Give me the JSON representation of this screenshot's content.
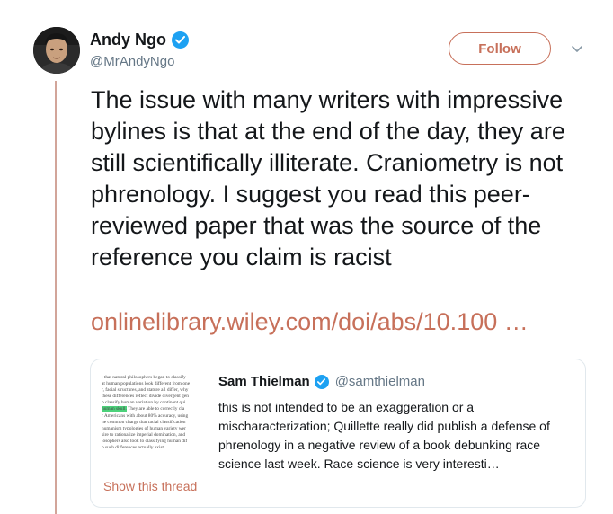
{
  "author": {
    "display_name": "Andy Ngo",
    "handle": "@MrAndyNgo"
  },
  "follow_button": {
    "label": "Follow"
  },
  "tweet": {
    "text": "The issue with many writers with impressive bylines is that at the end of the day, they are still scientifically illiterate. Craniometry is not phrenology. I suggest you read this peer-reviewed paper that was the source of the reference you claim is racist",
    "link_text": "onlinelibrary.wiley.com/doi/abs/10.100 …"
  },
  "quoted_tweet": {
    "display_name": "Sam Thielman",
    "handle": "@samthielman",
    "text": "this is not intended to be an exaggeration or a mischaracterization; Quillette really did publish a defense of phrenology in a negative review of a book debunking race science last week. Race science is very interesti…",
    "show_thread_label": "Show this thread",
    "thumbnail_lines": [
      "; that natural philosophers began to classify",
      "at human populations look different from one",
      "r, facial structures, and stature all differ, why",
      "these differences reflect divide divergent gen",
      "o classify human variation by continent qui",
      "[HL]human skull.[/HL] They are able to correctly cla",
      "r Americans with about 80% accuracy, using",
      "he common charge that racial classification",
      "humanism typologies of human variety wer",
      "sire to rationalize imperial domination, and",
      "iosophers also took to classifying human dif",
      "o such differences actually exist."
    ]
  },
  "colors": {
    "accent": "#c7705a",
    "verified": "#1da1f2",
    "secondary_text": "#657786",
    "thread_line": "#d2a59a"
  }
}
